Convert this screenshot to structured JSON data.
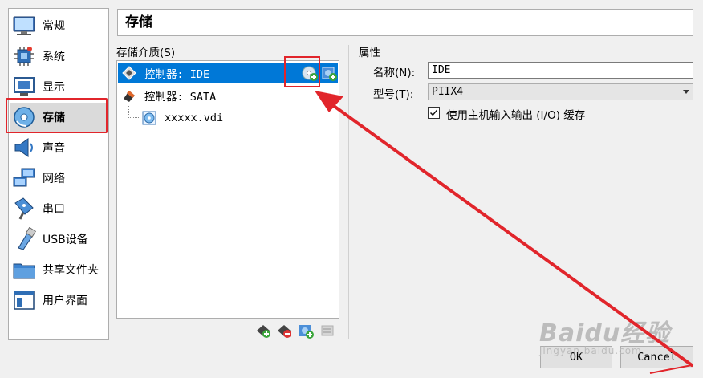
{
  "sidebar": {
    "items": [
      {
        "label": "常规",
        "icon": "monitor-icon"
      },
      {
        "label": "系统",
        "icon": "chip-icon"
      },
      {
        "label": "显示",
        "icon": "display-icon"
      },
      {
        "label": "存储",
        "icon": "disk-icon",
        "selected": true
      },
      {
        "label": "声音",
        "icon": "speaker-icon"
      },
      {
        "label": "网络",
        "icon": "network-icon"
      },
      {
        "label": "串口",
        "icon": "serial-port-icon"
      },
      {
        "label": "USB设备",
        "icon": "usb-icon"
      },
      {
        "label": "共享文件夹",
        "icon": "folder-icon"
      },
      {
        "label": "用户界面",
        "icon": "window-icon"
      }
    ]
  },
  "header": {
    "title": "存储"
  },
  "storage": {
    "group_label": "存储介质(S)",
    "controllers": [
      {
        "label": "控制器: IDE",
        "selected": true
      },
      {
        "label": "控制器: SATA"
      }
    ],
    "attachments": [
      {
        "label": "xxxxx.vdi"
      }
    ]
  },
  "attributes": {
    "group_label": "属性",
    "name_label": "名称(N):",
    "name_value": "IDE",
    "type_label": "型号(T):",
    "type_value": "PIIX4",
    "cache_label": "使用主机输入输出 (I/O) 缓存",
    "cache_checked": true
  },
  "buttons": {
    "ok": "OK",
    "cancel": "Cancel"
  },
  "watermark": {
    "text": "Baidu经验",
    "url": "jingyan.baidu.com"
  },
  "colors": {
    "selection": "#0078d7",
    "annotation": "#e1252b"
  }
}
